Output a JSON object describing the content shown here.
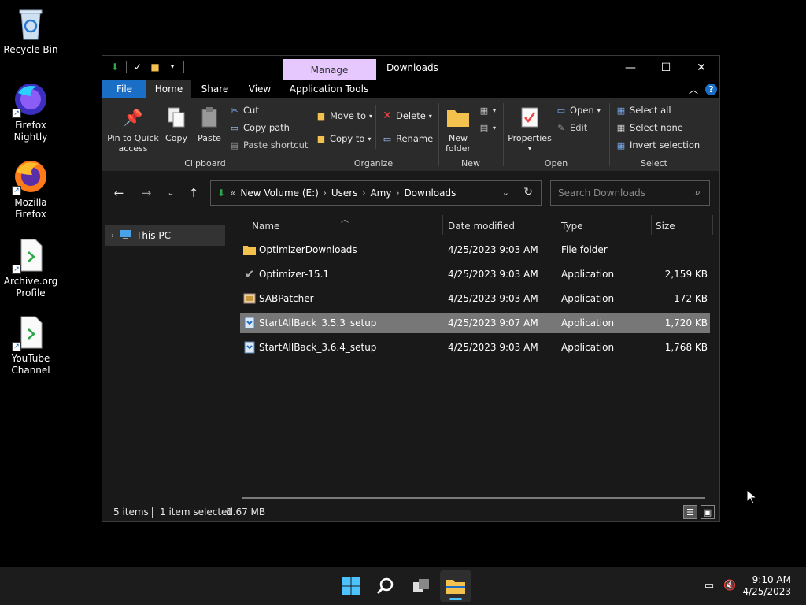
{
  "desktop": {
    "icons": [
      {
        "label_line1": "Recycle Bin",
        "label_line2": "",
        "icon": "recycle-bin-icon"
      },
      {
        "label_line1": "Firefox",
        "label_line2": "Nightly",
        "icon": "firefox-nightly-icon"
      },
      {
        "label_line1": "Mozilla",
        "label_line2": "Firefox",
        "icon": "firefox-icon"
      },
      {
        "label_line1": "Archive.org",
        "label_line2": "Profile",
        "icon": "shortcut-file-icon"
      },
      {
        "label_line1": "YouTube",
        "label_line2": "Channel",
        "icon": "shortcut-file-icon"
      }
    ]
  },
  "window": {
    "title": "Downloads",
    "context_tab": "Manage",
    "tabs": {
      "file": "File",
      "home": "Home",
      "share": "Share",
      "view": "View",
      "app_tools": "Application Tools"
    },
    "ribbon": {
      "clipboard": {
        "label": "Clipboard",
        "pin_line1": "Pin to Quick",
        "pin_line2": "access",
        "copy": "Copy",
        "paste": "Paste",
        "cut": "Cut",
        "copy_path": "Copy path",
        "paste_shortcut": "Paste shortcut"
      },
      "organize": {
        "label": "Organize",
        "move_to": "Move to",
        "copy_to": "Copy to",
        "delete": "Delete",
        "rename": "Rename"
      },
      "new": {
        "label": "New",
        "new_folder_line1": "New",
        "new_folder_line2": "folder"
      },
      "open": {
        "label": "Open",
        "properties": "Properties",
        "open": "Open",
        "edit": "Edit"
      },
      "select": {
        "label": "Select",
        "select_all": "Select all",
        "select_none": "Select none",
        "invert": "Invert selection"
      }
    },
    "address": {
      "prefix": "«",
      "crumbs": [
        "New Volume (E:)",
        "Users",
        "Amy",
        "Downloads"
      ]
    },
    "search": {
      "placeholder": "Search Downloads"
    },
    "navpane": {
      "this_pc": "This PC"
    },
    "columns": {
      "name": "Name",
      "date": "Date modified",
      "type": "Type",
      "size": "Size"
    },
    "files": [
      {
        "name": "OptimizerDownloads",
        "date": "4/25/2023 9:03 AM",
        "type": "File folder",
        "size": "",
        "icon": "folder-icon",
        "selected": false
      },
      {
        "name": "Optimizer-15.1",
        "date": "4/25/2023 9:03 AM",
        "type": "Application",
        "size": "2,159 KB",
        "icon": "checkmark-app-icon",
        "selected": false
      },
      {
        "name": "SABPatcher",
        "date": "4/25/2023 9:03 AM",
        "type": "Application",
        "size": "172 KB",
        "icon": "patcher-app-icon",
        "selected": false
      },
      {
        "name": "StartAllBack_3.5.3_setup",
        "date": "4/25/2023 9:07 AM",
        "type": "Application",
        "size": "1,720 KB",
        "icon": "installer-icon",
        "selected": true
      },
      {
        "name": "StartAllBack_3.6.4_setup",
        "date": "4/25/2023 9:03 AM",
        "type": "Application",
        "size": "1,768 KB",
        "icon": "installer-icon",
        "selected": false
      }
    ],
    "status": {
      "items": "5 items",
      "selected": "1 item selected",
      "size": "1.67 MB"
    }
  },
  "taskbar": {
    "time": "9:10 AM",
    "date": "4/25/2023"
  },
  "colors": {
    "accent": "#1a6ec6",
    "manage_tab": "#e6c8ff",
    "selected_row": "#777777",
    "taskbar_indicator": "#4cc2ff"
  }
}
